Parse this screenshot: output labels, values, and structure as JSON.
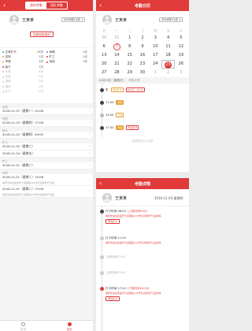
{
  "colors": {
    "accent": "#e03a3a",
    "orange": "#e8a23a",
    "green": "#34b36a",
    "blue": "#3a8ee0"
  },
  "left": {
    "tabs": [
      "我的考勤",
      "团队考勤"
    ],
    "active_tab": 0,
    "user_name": "王某某",
    "month": "2016年11月",
    "view_rules_btn": "查看考勤规则",
    "stats": [
      [
        {
          "label": "正常打卡",
          "value": "20天",
          "color": "#34b36a"
        },
        {
          "label": "休假",
          "value": "1天",
          "color": "#3a8ee0"
        }
      ],
      [
        {
          "label": "迟到",
          "value": "1次",
          "color": "#e8a23a"
        },
        {
          "label": "旷工",
          "value": "1天",
          "color": "#e03a3a"
        }
      ],
      [
        {
          "label": "早退",
          "value": "1次",
          "color": "#e8a23a"
        },
        {
          "label": "加班",
          "value": "1天",
          "color": "#e03a3a"
        }
      ],
      [
        {
          "label": "缺卡",
          "value": "1次",
          "color": "#e03a3a"
        },
        {
          "label": "",
          "value": "",
          "color": ""
        }
      ],
      [
        {
          "label": "外勤",
          "value": "0次",
          "color": "#cccccc",
          "gray": true
        },
        {
          "label": "",
          "value": "",
          "color": ""
        }
      ],
      [
        {
          "label": "出差",
          "value": "0天",
          "color": "#cccccc",
          "gray": true
        },
        {
          "label": "",
          "value": "",
          "color": ""
        }
      ],
      [
        {
          "label": "请假",
          "value": "0天",
          "color": "#cccccc",
          "gray": true
        },
        {
          "label": "",
          "value": "",
          "color": ""
        }
      ],
      [
        {
          "label": "调休",
          "value": "0天",
          "color": "#cccccc",
          "gray": true
        },
        {
          "label": "",
          "value": "",
          "color": ""
        }
      ],
      [
        {
          "label": "补卡",
          "value": "0次",
          "color": "#cccccc",
          "gray": true
        },
        {
          "label": "",
          "value": "",
          "color": ""
        }
      ]
    ],
    "sections": [
      {
        "title": "迟到",
        "rows": [
          {
            "text": "2016-11-07（星期一）10:06"
          }
        ]
      },
      {
        "title": "早退",
        "rows": [
          {
            "text": "2016-11-03（星期四）17:06"
          }
        ]
      },
      {
        "title": "缺卡",
        "rows": [
          {
            "text": "2016-11-03（星期四）09:00"
          }
        ]
      },
      {
        "title": "旷工",
        "rows": [
          {
            "text": "2016-11-02（星期三）"
          },
          {
            "text": "2016-11-04（星期五）"
          }
        ]
      },
      {
        "title": "旷工",
        "rows": [
          {
            "text": "2016-11-01（星期二）"
          }
        ]
      },
      {
        "title": "外勤",
        "rows2": [
          {
            "text": "2016-11-01（星期二）15:06",
            "sub": "重庆市渝北区金开大道西段101号亿达软件产业园"
          },
          {
            "text": "2016-11-01（星期二）15:06",
            "sub": "重庆市渝北区金开大道西段101号亿达软件产业园"
          }
        ]
      }
    ],
    "tabbar": [
      {
        "label": "打卡",
        "active": false
      },
      {
        "label": "统计",
        "active": true
      }
    ]
  },
  "cal": {
    "title": "考勤日历",
    "user_name": "王某某",
    "month": "2016年11月",
    "weekdays": [
      "日",
      "一",
      "二",
      "三",
      "四",
      "五",
      "六"
    ],
    "days": [
      {
        "n": "30",
        "muted": true,
        "m": ""
      },
      {
        "n": "31",
        "muted": true,
        "m": ""
      },
      {
        "n": "1",
        "m": "•"
      },
      {
        "n": "2",
        "m": "•"
      },
      {
        "n": "3",
        "m": "•"
      },
      {
        "n": "4",
        "m": "•"
      },
      {
        "n": "5",
        "m": ""
      },
      {
        "n": "6",
        "m": ""
      },
      {
        "n": "7",
        "red": true,
        "m": ""
      },
      {
        "n": "8",
        "m": ""
      },
      {
        "n": "9",
        "m": ""
      },
      {
        "n": "10",
        "m": ""
      },
      {
        "n": "11",
        "m": ""
      },
      {
        "n": "12",
        "m": ""
      },
      {
        "n": "13",
        "m": ""
      },
      {
        "n": "14",
        "m": ""
      },
      {
        "n": "15",
        "m": ""
      },
      {
        "n": "16",
        "m": ""
      },
      {
        "n": "17",
        "m": ""
      },
      {
        "n": "18",
        "m": ""
      },
      {
        "n": "19",
        "m": ""
      },
      {
        "n": "20",
        "m": ""
      },
      {
        "n": "21",
        "m": ""
      },
      {
        "n": "22",
        "m": ""
      },
      {
        "n": "23",
        "m": ""
      },
      {
        "n": "24",
        "m": ""
      },
      {
        "n": "25",
        "sel": true,
        "m": ""
      },
      {
        "n": "26",
        "m": ""
      },
      {
        "n": "27",
        "m": ""
      },
      {
        "n": "28",
        "m": ""
      },
      {
        "n": "29",
        "m": ""
      },
      {
        "n": "30",
        "m": ""
      },
      {
        "n": "1",
        "muted": true,
        "m": ""
      },
      {
        "n": "2",
        "muted": true,
        "m": ""
      },
      {
        "n": "3",
        "muted": true,
        "m": ""
      }
    ],
    "detail_date": "11月25日（星期五）",
    "detail_status": "考勤正常",
    "timeline": [
      {
        "time": "失",
        "tag": "申请补卡",
        "tag2": "09:00 - 12:00",
        "dot": "g"
      },
      {
        "time": "11:00",
        "tag": "迟到",
        "tag2": "",
        "dot": "g",
        "tagcls": "org"
      },
      {
        "time": "14:00",
        "tag": "正常",
        "tag2": "",
        "dot": ""
      },
      {
        "time": "17:30",
        "tag": "早退",
        "tag2": "申请补卡",
        "dot": "g",
        "tagcls": "org"
      }
    ],
    "more_link": "查看更多打卡记录"
  },
  "det": {
    "title": "考勤详情",
    "user_name": "王某某",
    "date": "2016-11-03 星期四",
    "nodes": [
      {
        "title": "打卡时间 08:50",
        "flag": "(上班时间9:00)",
        "loc": "重庆市渝北区金开大道西段101号亿达软件产业园E栋",
        "btn": "申请补卡",
        "dot": "g"
      },
      {
        "title": "打卡时间 11:50",
        "flag": "",
        "loc": "重庆市渝北区金开大道西段101号亿达软件产业园E栋",
        "btn": "",
        "dot": ""
      },
      {
        "title": "下班时间12:30",
        "flag": "",
        "loc": "",
        "btn": "",
        "dot": "",
        "gray": true
      },
      {
        "title": "上班时间13:30",
        "flag": "",
        "loc": "",
        "btn": "",
        "dot": "",
        "gray": true
      },
      {
        "title": "打卡时间 17:02",
        "flag": "(下班时间18:00)",
        "loc": "重庆市渝北区金开大道西段101号亿达软件产业园E栋",
        "btn": "申请补卡",
        "dot": "r"
      }
    ]
  }
}
